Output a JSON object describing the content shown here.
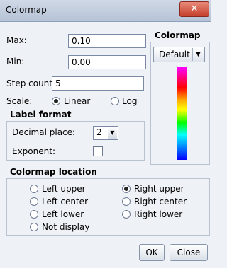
{
  "window": {
    "title": "Colormap",
    "close_symbol": "✕"
  },
  "fields": {
    "max": {
      "label": "Max:",
      "value": "0.10"
    },
    "min": {
      "label": "Min:",
      "value": "0.00"
    },
    "step_count": {
      "label": "Step count:",
      "value": "5"
    }
  },
  "scale": {
    "label": "Scale:",
    "options": [
      {
        "label": "Linear",
        "selected": true
      },
      {
        "label": "Log",
        "selected": false
      }
    ]
  },
  "label_format": {
    "title": "Label format",
    "decimal_place": {
      "label": "Decimal place:",
      "value": "2"
    },
    "exponent": {
      "label": "Exponent:",
      "checked": false
    }
  },
  "colormap_panel": {
    "title": "Colormap",
    "selected": "Default",
    "colors": [
      "#ff00ff",
      "#ff0000",
      "#ffb000",
      "#ffff00",
      "#00ff00",
      "#00ffff",
      "#0000ff"
    ]
  },
  "location": {
    "title": "Colormap location",
    "options": [
      {
        "label": "Left upper",
        "selected": false
      },
      {
        "label": "Right upper",
        "selected": true
      },
      {
        "label": "Left center",
        "selected": false
      },
      {
        "label": "Right center",
        "selected": false
      },
      {
        "label": "Left lower",
        "selected": false
      },
      {
        "label": "Right lower",
        "selected": false
      },
      {
        "label": "Not display",
        "selected": false
      }
    ]
  },
  "buttons": {
    "ok": "OK",
    "close": "Close"
  }
}
